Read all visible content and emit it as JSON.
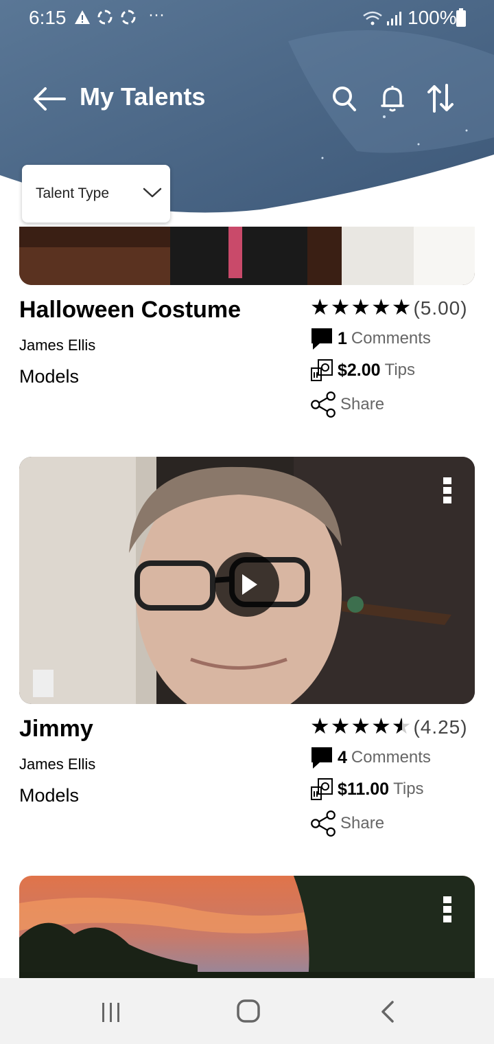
{
  "status_bar": {
    "time": "6:15",
    "battery": "100%",
    "icons": [
      "warning-icon",
      "recycle-icon",
      "recycle-icon",
      "more-icon",
      "wifi-icon",
      "signal-icon",
      "battery-icon"
    ]
  },
  "header": {
    "title": "My Talents",
    "icons": [
      "back-arrow-icon",
      "search-icon",
      "bell-icon",
      "sort-icon"
    ]
  },
  "filter": {
    "label": "Talent Type"
  },
  "talents": [
    {
      "title": "Halloween Costume",
      "author": "James Ellis",
      "category": "Models",
      "stars": 5.0,
      "rating": "(5.00)",
      "comments_count": "1",
      "comments_label": "Comments",
      "tips_amount": "$2.00",
      "tips_label": "Tips",
      "share_label": "Share"
    },
    {
      "title": "Jimmy",
      "author": "James Ellis",
      "category": "Models",
      "stars": 4.25,
      "rating": "(4.25)",
      "comments_count": "4",
      "comments_label": "Comments",
      "tips_amount": "$11.00",
      "tips_label": "Tips",
      "share_label": "Share"
    }
  ],
  "colors": {
    "header_blue": "#4a6585",
    "text_dark": "#000000",
    "text_gray": "#666666"
  },
  "nav": {
    "icons": [
      "recent-apps-icon",
      "home-icon",
      "back-icon"
    ]
  }
}
